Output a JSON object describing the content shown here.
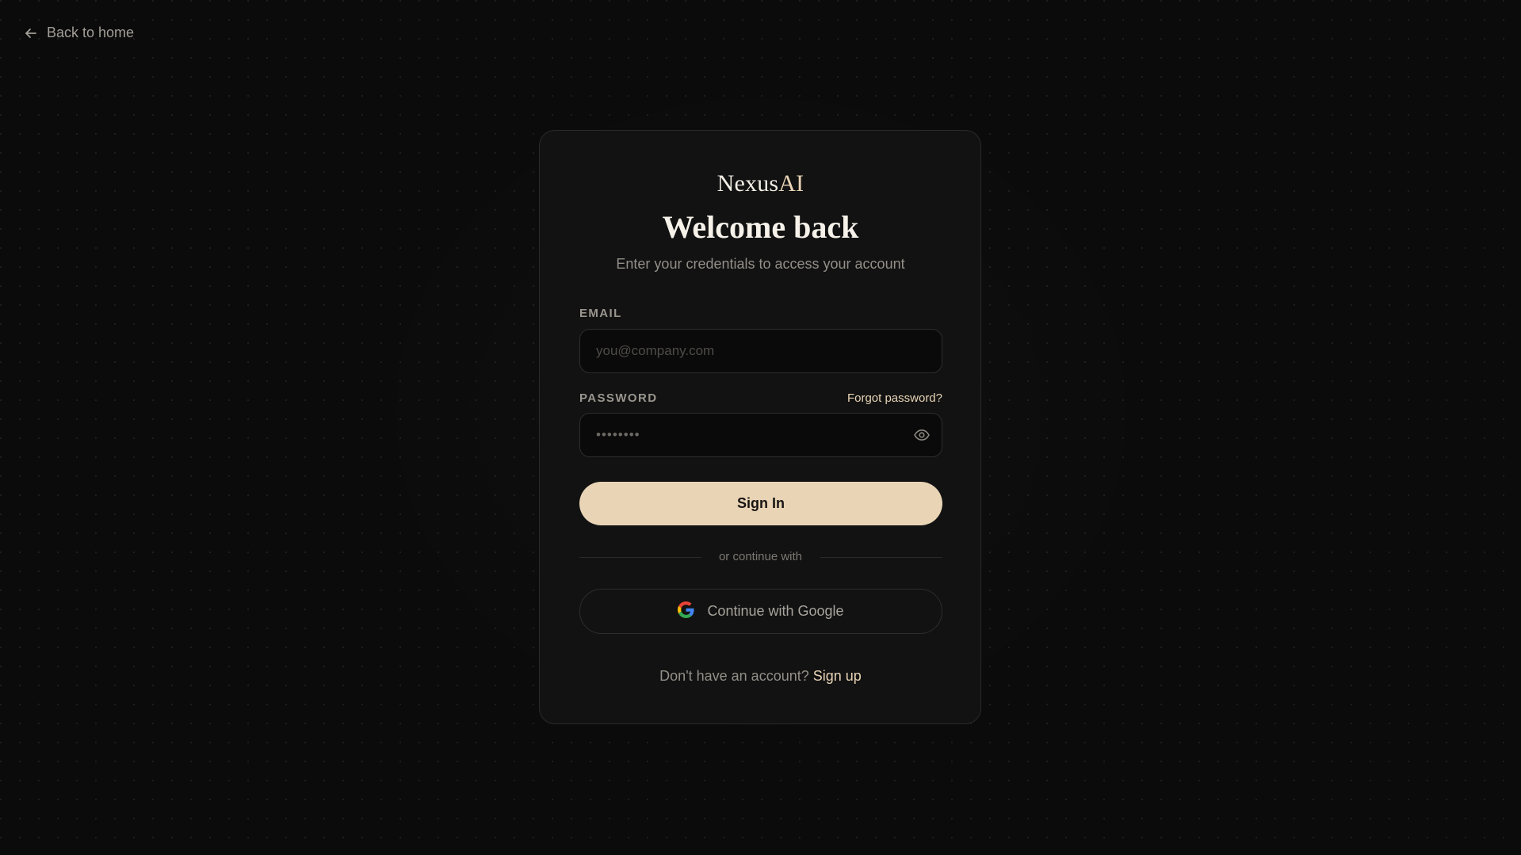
{
  "nav": {
    "back_label": "Back to home"
  },
  "brand": {
    "name_main": "Nexus",
    "name_accent": "AI"
  },
  "header": {
    "title": "Welcome back",
    "subtitle": "Enter your credentials to access your account"
  },
  "form": {
    "email_label": "EMAIL",
    "email_placeholder": "you@company.com",
    "email_value": "",
    "password_label": "PASSWORD",
    "password_placeholder": "••••••••",
    "password_value": "",
    "forgot_label": "Forgot password?",
    "submit_label": "Sign In"
  },
  "divider": {
    "label": "or continue with"
  },
  "oauth": {
    "google_label": "Continue with Google"
  },
  "footer": {
    "prompt": "Don't have an account?",
    "signup_label": "Sign up"
  },
  "icons": {
    "back": "arrow-left-icon",
    "password_toggle": "eye-icon",
    "google": "google-logo-icon"
  },
  "colors": {
    "background": "#0b0b0b",
    "card": "#121212",
    "accent": "#e9d4b6",
    "muted_text": "#938f88"
  }
}
